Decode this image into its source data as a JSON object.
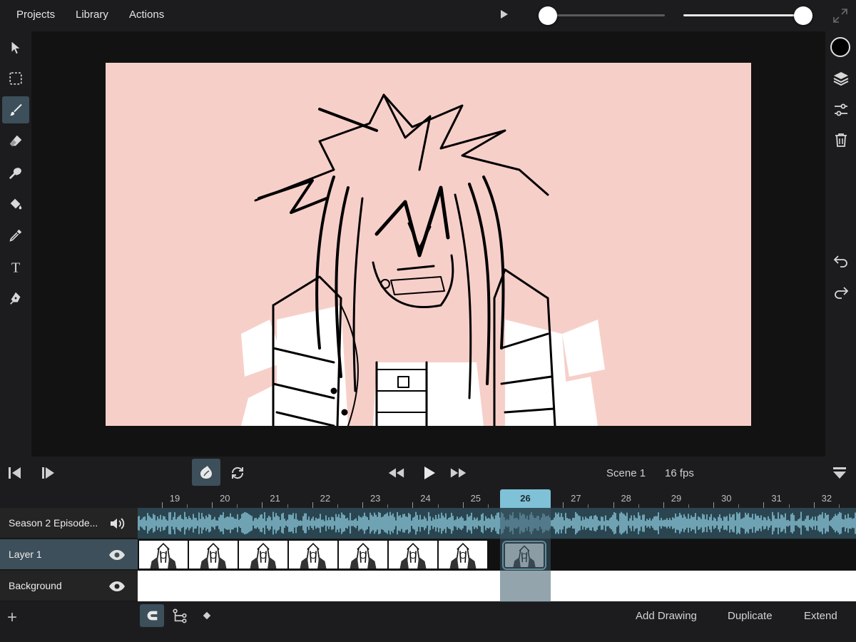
{
  "menu": {
    "projects": "Projects",
    "library": "Library",
    "actions": "Actions"
  },
  "colors": {
    "accent": "#7fc1d6",
    "selected": "#3c4f5a",
    "canvas": "#f7cfc9",
    "current_color": "#000000"
  },
  "sliders": {
    "brush_size": 0.0,
    "opacity": 1.0
  },
  "left_tools": [
    {
      "name": "select-arrow-icon"
    },
    {
      "name": "marquee-select-icon"
    },
    {
      "name": "brush-icon",
      "active": true
    },
    {
      "name": "eraser-icon"
    },
    {
      "name": "smudge-icon"
    },
    {
      "name": "paint-bucket-icon"
    },
    {
      "name": "eyedropper-icon"
    },
    {
      "name": "text-tool-icon"
    },
    {
      "name": "pen-tool-icon"
    }
  ],
  "right_tools": [
    "color-swatch",
    "layers-icon",
    "adjustments-icon",
    "trash-icon",
    "undo-icon",
    "redo-icon"
  ],
  "playback": {
    "scene": "Scene 1",
    "fps": "16 fps"
  },
  "timeline": {
    "frames": [
      "19",
      "20",
      "21",
      "22",
      "23",
      "24",
      "25",
      "26",
      "27",
      "28",
      "29",
      "30",
      "31",
      "32"
    ],
    "current_frame": "26",
    "tracks": [
      {
        "name": "Season 2 Episode...",
        "icon": "speaker-icon",
        "type": "audio"
      },
      {
        "name": "Layer 1",
        "icon": "eye-icon",
        "type": "drawing",
        "selected": true
      },
      {
        "name": "Background",
        "icon": "eye-icon",
        "type": "background"
      }
    ]
  },
  "bottom": {
    "add_drawing": "Add Drawing",
    "duplicate": "Duplicate",
    "extend": "Extend",
    "add": "+"
  }
}
